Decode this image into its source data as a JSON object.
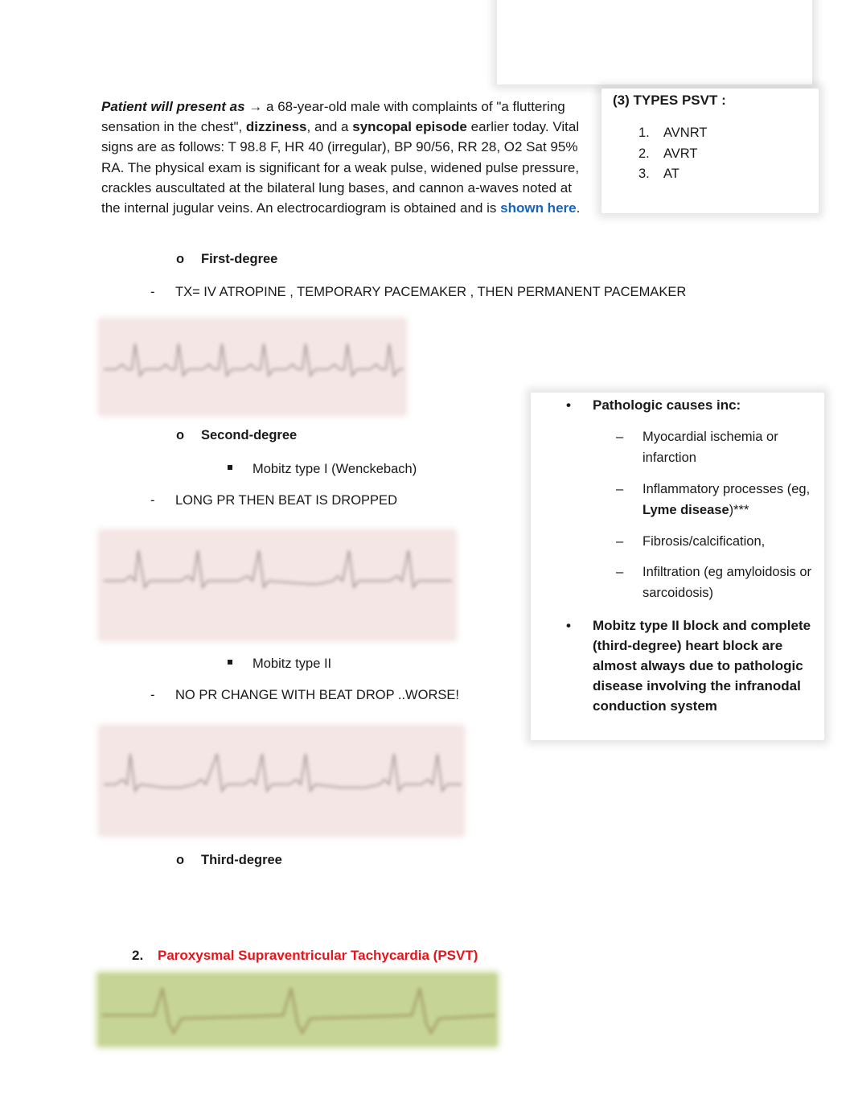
{
  "colors": {
    "link": "#1565c0",
    "heading_red": "#e8141b",
    "ecg_pink": "#f3e6e4",
    "ecg_green": "#c6d496"
  },
  "intro": {
    "lead": "Patient will present as",
    "arrow": "→",
    "t1": " a 68-year-old male with complaints of \"a fluttering sensation in the chest\", ",
    "b1": "dizziness",
    "t2": ", and a ",
    "b2": "syncopal episode",
    "t3": " earlier today. Vital signs are as follows: T 98.8 F, HR 40 (irregular), BP 90/56, RR 28, O2 Sat 95% RA. The physical exam is significant for a weak pulse, widened pulse pressure, crackles auscultated at the bilateral lung bases, and cannon a-waves noted at the internal jugular veins. An electrocardiogram is obtained and is ",
    "link": "shown here",
    "t4": "."
  },
  "psvt_box": {
    "title": "(3) TYPES PSVT :",
    "items": [
      {
        "num": "1.",
        "label": "AVNRT"
      },
      {
        "num": "2.",
        "label": "AVRT"
      },
      {
        "num": "3.",
        "label": "AT"
      }
    ]
  },
  "outline": {
    "bullet_o": "o",
    "dash": "-",
    "first_degree": "First-degree",
    "first_tx": "TX= IV ATROPINE , TEMPORARY PACEMAKER , THEN PERMANENT PACEMAKER",
    "second_degree": "Second-degree",
    "mobitz1": "Mobitz type I (Wenckebach)",
    "mobitz1_note": "LONG PR THEN BEAT IS DROPPED",
    "mobitz2": "Mobitz type II",
    "mobitz2_note": "NO PR CHANGE WITH BEAT DROP ..WORSE!",
    "third_degree": "Third-degree"
  },
  "psvt_heading": {
    "num": "2.",
    "label": "Paroxysmal Supraventricular Tachycardia (PSVT)"
  },
  "path_box": {
    "bullet": "•",
    "dash": "–",
    "heading": "Pathologic causes inc:",
    "causes": [
      {
        "pre": "Myocardial ischemia or infarction",
        "bold": "",
        "post": ""
      },
      {
        "pre": "Inflammatory processes (eg, ",
        "bold": "Lyme disease",
        "post": ")***"
      },
      {
        "pre": "Fibrosis/calcification,",
        "bold": "",
        "post": ""
      },
      {
        "pre": "Infiltration (eg amyloidosis or sarcoidosis)",
        "bold": "",
        "post": ""
      }
    ],
    "mobitz_note": "Mobitz type II block and complete (third-degree) heart block are almost always due to pathologic disease involving the infranodal conduction system"
  },
  "ecg_images": [
    {
      "name": "first-degree-ecg",
      "alt": "First-degree AV block ECG strip"
    },
    {
      "name": "mobitz-1-ecg",
      "alt": "Mobitz type I ECG strip"
    },
    {
      "name": "mobitz-2-ecg",
      "alt": "Mobitz type II ECG strip"
    },
    {
      "name": "psvt-ecg",
      "alt": "PSVT ECG strip"
    }
  ]
}
